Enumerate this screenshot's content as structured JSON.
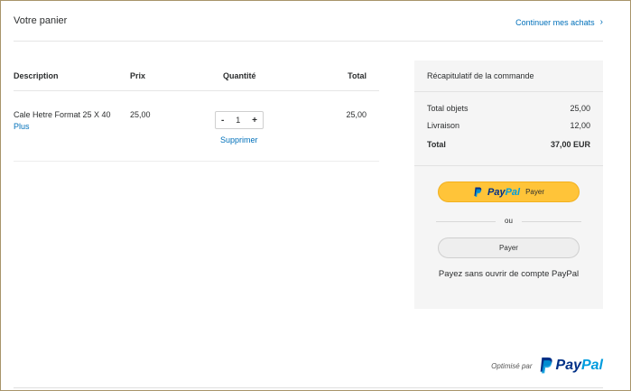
{
  "header": {
    "title": "Votre panier",
    "continue_label": "Continuer mes achats",
    "continue_chevron": "›"
  },
  "cart": {
    "columns": {
      "description": "Description",
      "price": "Prix",
      "quantity": "Quantité",
      "total": "Total"
    },
    "items": [
      {
        "name": "Cale Hetre Format 25 X 40",
        "more_label": "Plus",
        "price": "25,00",
        "qty_minus": "-",
        "quantity": "1",
        "qty_plus": "+",
        "remove_label": "Supprimer",
        "total": "25,00"
      }
    ]
  },
  "summary": {
    "title": "Récapitulatif de la commande",
    "lines": [
      {
        "label": "Total objets",
        "value": "25,00"
      },
      {
        "label": "Livraison",
        "value": "12,00"
      },
      {
        "label": "Total",
        "value": "37,00 EUR"
      }
    ],
    "paypal_button": {
      "brand_pay": "Pay",
      "brand_pal": "Pal",
      "label": "Payer"
    },
    "or_label": "ou",
    "pay_button_label": "Payer",
    "no_account_text": "Payez sans ouvrir de compte PayPal"
  },
  "footer": {
    "optimised_by": "Optimisé par",
    "brand_pay": "Pay",
    "brand_pal": "Pal"
  },
  "colors": {
    "link": "#0070ba",
    "paypal_yellow": "#ffc439",
    "paypal_dark_blue": "#003087",
    "paypal_light_blue": "#009cde",
    "summary_bg": "#f5f5f5",
    "frame_border": "#a8946a"
  },
  "icons": [
    "chevron-right-icon",
    "paypal-mark-icon"
  ]
}
